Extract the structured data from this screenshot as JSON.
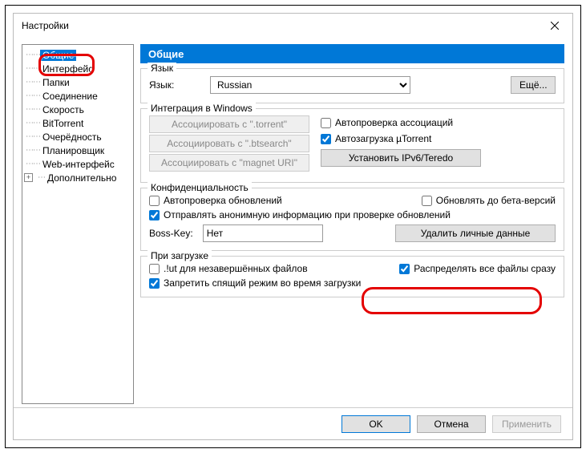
{
  "window": {
    "title": "Настройки"
  },
  "tree": {
    "items": [
      "Общие",
      "Интерфейс",
      "Папки",
      "Соединение",
      "Скорость",
      "BitTorrent",
      "Очерёдность",
      "Планировщик",
      "Web-интерфейс",
      "Дополнительно"
    ]
  },
  "header": "Общие",
  "lang": {
    "legend": "Язык",
    "label": "Язык:",
    "value": "Russian",
    "more": "Ещё..."
  },
  "integ": {
    "legend": "Интеграция в Windows",
    "btn_torrent": "Ассоциировать с \".torrent\"",
    "btn_btsearch": "Ассоциировать с \".btsearch\"",
    "btn_magnet": "Ассоциировать с \"magnet URI\"",
    "chk_autocheck": "Автопроверка ассоциаций",
    "chk_autoload": "Автозагрузка µTorrent",
    "btn_ipv6": "Установить IPv6/Teredo"
  },
  "conf": {
    "legend": "Конфиденциальность",
    "chk_update": "Автопроверка обновлений",
    "chk_beta": "Обновлять до бета-версий",
    "chk_anon": "Отправлять анонимную информацию при проверке обновлений",
    "bosskey_label": "Boss-Key:",
    "bosskey_value": "Нет",
    "btn_delete": "Удалить личные данные"
  },
  "dl": {
    "legend": "При загрузке",
    "chk_ut": ".!ut для незавершённых файлов",
    "chk_prealloc": "Распределять все файлы сразу",
    "chk_sleep": "Запретить спящий режим во время загрузки"
  },
  "footer": {
    "ok": "OK",
    "cancel": "Отмена",
    "apply": "Применить"
  }
}
